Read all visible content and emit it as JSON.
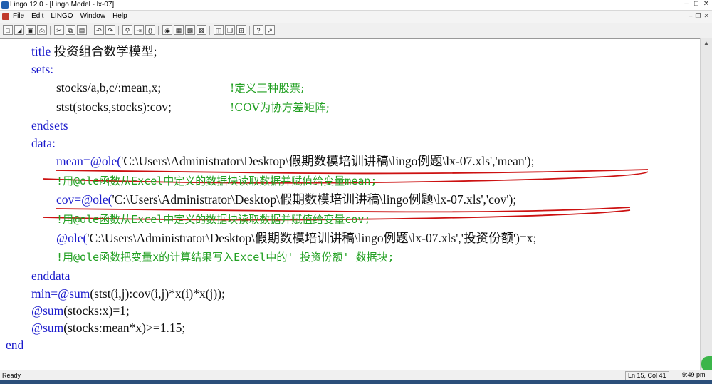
{
  "window": {
    "title": "Lingo 12.0 - [Lingo Model - lx-07]"
  },
  "menu": {
    "items": [
      "File",
      "Edit",
      "LINGO",
      "Window",
      "Help"
    ]
  },
  "code": {
    "l1a": "title",
    "l1b": " 投资组合数学模型;",
    "l2": "sets:",
    "l3": "stocks/a,b,c/:mean,x;",
    "l3c": "!定义三种股票;",
    "l4": "stst(stocks,stocks):cov;",
    "l4c": "!COV为协方差矩阵;",
    "l5": "endsets",
    "l6": "data:",
    "l7a": "mean=@ole(",
    "l7b": "'C:\\Users\\Administrator\\Desktop\\假期数模培训讲稿\\lingo例题\\lx-07.xls','mean');",
    "l8": "!用@ole函数从Excel中定义的数据块读取数据并赋值给变量mean;",
    "l9a": "cov=@ole(",
    "l9b": "'C:\\Users\\Administrator\\Desktop\\假期数模培训讲稿\\lingo例题\\lx-07.xls','cov');",
    "l10": "!用@ole函数从Excel中定义的数据块读取数据并赋值给变量cov;",
    "l11a": "@ole(",
    "l11b": "'C:\\Users\\Administrator\\Desktop\\假期数模培训讲稿\\lingo例题\\lx-07.xls','投资份额')=x;",
    "l12": "!用@ole函数把变量x的计算结果写入Excel中的' 投资份额' 数据块;",
    "l13": "enddata",
    "l14a": "min=",
    "l14b": "@sum",
    "l14c": "(stst(i,j):cov(i,j)*x(i)*x(j));",
    "l15a": "@sum",
    "l15b": "(stocks:x)=1;",
    "l16a": "@sum",
    "l16b": "(stocks:mean*x)>=1.15;",
    "l17": "end"
  },
  "status": {
    "ready": "Ready",
    "position": "Ln 15, Col 41",
    "time": "9:49 pm"
  },
  "colors": {
    "keyword": "#1a1acc",
    "comment": "#22a022",
    "annotation": "#cc1111"
  }
}
